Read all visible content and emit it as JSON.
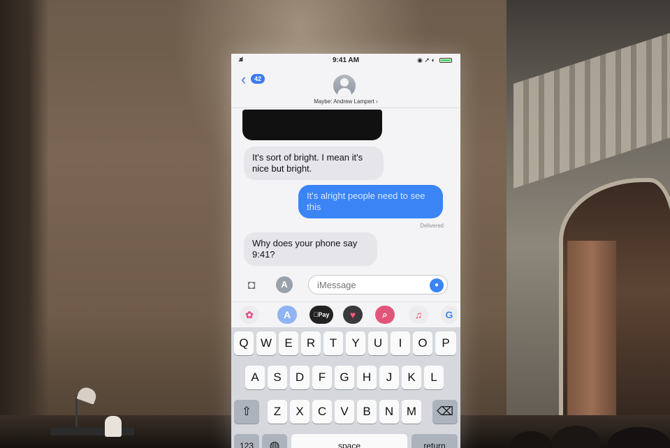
{
  "phone": {
    "status_bar": {
      "time": "9:41 AM"
    },
    "nav": {
      "back_count": "42",
      "contact_name": "Maybe: Andrew Lampert ›"
    },
    "messages": [
      {
        "direction": "incoming",
        "text": "It's sort of bright. I mean it's nice but bright."
      },
      {
        "direction": "outgoing",
        "text": "It's alright people need to see this"
      },
      {
        "direction": "incoming",
        "text": "Why does your phone say 9:41?"
      }
    ],
    "delivered_label": "Delivered",
    "compose": {
      "placeholder": "iMessage"
    },
    "app_strip": {
      "pay_label": "Pay"
    },
    "keyboard": {
      "row1": [
        "Q",
        "W",
        "E",
        "R",
        "T",
        "Y",
        "U",
        "I",
        "O",
        "P"
      ],
      "row2": [
        "A",
        "S",
        "D",
        "F",
        "G",
        "H",
        "J",
        "K",
        "L"
      ],
      "row3": [
        "Z",
        "X",
        "C",
        "V",
        "B",
        "N",
        "M"
      ],
      "space_label": "space",
      "return_label": "return",
      "numbers_label": "123"
    }
  },
  "icons": {
    "back": "chevron-left-icon",
    "camera": "camera-icon",
    "app_store": "app-store-icon",
    "mic": "microphone-icon",
    "shift": "shift-icon",
    "delete": "delete-icon",
    "globe": "globe-icon"
  },
  "colors": {
    "imessage_blue": "#3a84f6",
    "incoming_bubble": "#e5e5ea",
    "wall": "#7a6652"
  }
}
